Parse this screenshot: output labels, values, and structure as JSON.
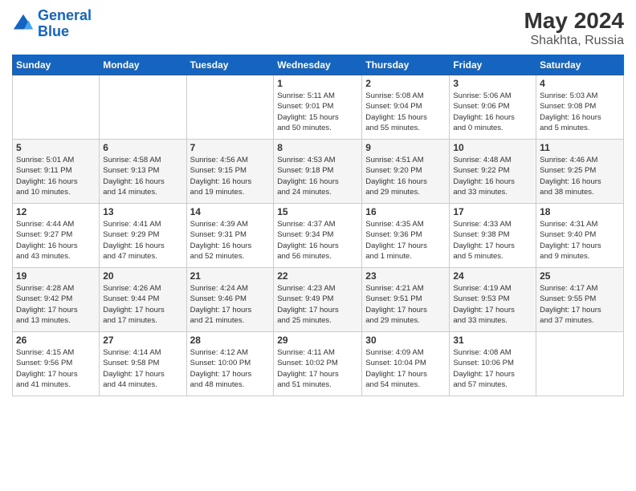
{
  "header": {
    "logo_line1": "General",
    "logo_line2": "Blue",
    "month_year": "May 2024",
    "location": "Shakhta, Russia"
  },
  "days_of_week": [
    "Sunday",
    "Monday",
    "Tuesday",
    "Wednesday",
    "Thursday",
    "Friday",
    "Saturday"
  ],
  "weeks": [
    [
      {
        "day": "",
        "info": ""
      },
      {
        "day": "",
        "info": ""
      },
      {
        "day": "",
        "info": ""
      },
      {
        "day": "1",
        "info": "Sunrise: 5:11 AM\nSunset: 9:01 PM\nDaylight: 15 hours\nand 50 minutes."
      },
      {
        "day": "2",
        "info": "Sunrise: 5:08 AM\nSunset: 9:04 PM\nDaylight: 15 hours\nand 55 minutes."
      },
      {
        "day": "3",
        "info": "Sunrise: 5:06 AM\nSunset: 9:06 PM\nDaylight: 16 hours\nand 0 minutes."
      },
      {
        "day": "4",
        "info": "Sunrise: 5:03 AM\nSunset: 9:08 PM\nDaylight: 16 hours\nand 5 minutes."
      }
    ],
    [
      {
        "day": "5",
        "info": "Sunrise: 5:01 AM\nSunset: 9:11 PM\nDaylight: 16 hours\nand 10 minutes."
      },
      {
        "day": "6",
        "info": "Sunrise: 4:58 AM\nSunset: 9:13 PM\nDaylight: 16 hours\nand 14 minutes."
      },
      {
        "day": "7",
        "info": "Sunrise: 4:56 AM\nSunset: 9:15 PM\nDaylight: 16 hours\nand 19 minutes."
      },
      {
        "day": "8",
        "info": "Sunrise: 4:53 AM\nSunset: 9:18 PM\nDaylight: 16 hours\nand 24 minutes."
      },
      {
        "day": "9",
        "info": "Sunrise: 4:51 AM\nSunset: 9:20 PM\nDaylight: 16 hours\nand 29 minutes."
      },
      {
        "day": "10",
        "info": "Sunrise: 4:48 AM\nSunset: 9:22 PM\nDaylight: 16 hours\nand 33 minutes."
      },
      {
        "day": "11",
        "info": "Sunrise: 4:46 AM\nSunset: 9:25 PM\nDaylight: 16 hours\nand 38 minutes."
      }
    ],
    [
      {
        "day": "12",
        "info": "Sunrise: 4:44 AM\nSunset: 9:27 PM\nDaylight: 16 hours\nand 43 minutes."
      },
      {
        "day": "13",
        "info": "Sunrise: 4:41 AM\nSunset: 9:29 PM\nDaylight: 16 hours\nand 47 minutes."
      },
      {
        "day": "14",
        "info": "Sunrise: 4:39 AM\nSunset: 9:31 PM\nDaylight: 16 hours\nand 52 minutes."
      },
      {
        "day": "15",
        "info": "Sunrise: 4:37 AM\nSunset: 9:34 PM\nDaylight: 16 hours\nand 56 minutes."
      },
      {
        "day": "16",
        "info": "Sunrise: 4:35 AM\nSunset: 9:36 PM\nDaylight: 17 hours\nand 1 minute."
      },
      {
        "day": "17",
        "info": "Sunrise: 4:33 AM\nSunset: 9:38 PM\nDaylight: 17 hours\nand 5 minutes."
      },
      {
        "day": "18",
        "info": "Sunrise: 4:31 AM\nSunset: 9:40 PM\nDaylight: 17 hours\nand 9 minutes."
      }
    ],
    [
      {
        "day": "19",
        "info": "Sunrise: 4:28 AM\nSunset: 9:42 PM\nDaylight: 17 hours\nand 13 minutes."
      },
      {
        "day": "20",
        "info": "Sunrise: 4:26 AM\nSunset: 9:44 PM\nDaylight: 17 hours\nand 17 minutes."
      },
      {
        "day": "21",
        "info": "Sunrise: 4:24 AM\nSunset: 9:46 PM\nDaylight: 17 hours\nand 21 minutes."
      },
      {
        "day": "22",
        "info": "Sunrise: 4:23 AM\nSunset: 9:49 PM\nDaylight: 17 hours\nand 25 minutes."
      },
      {
        "day": "23",
        "info": "Sunrise: 4:21 AM\nSunset: 9:51 PM\nDaylight: 17 hours\nand 29 minutes."
      },
      {
        "day": "24",
        "info": "Sunrise: 4:19 AM\nSunset: 9:53 PM\nDaylight: 17 hours\nand 33 minutes."
      },
      {
        "day": "25",
        "info": "Sunrise: 4:17 AM\nSunset: 9:55 PM\nDaylight: 17 hours\nand 37 minutes."
      }
    ],
    [
      {
        "day": "26",
        "info": "Sunrise: 4:15 AM\nSunset: 9:56 PM\nDaylight: 17 hours\nand 41 minutes."
      },
      {
        "day": "27",
        "info": "Sunrise: 4:14 AM\nSunset: 9:58 PM\nDaylight: 17 hours\nand 44 minutes."
      },
      {
        "day": "28",
        "info": "Sunrise: 4:12 AM\nSunset: 10:00 PM\nDaylight: 17 hours\nand 48 minutes."
      },
      {
        "day": "29",
        "info": "Sunrise: 4:11 AM\nSunset: 10:02 PM\nDaylight: 17 hours\nand 51 minutes."
      },
      {
        "day": "30",
        "info": "Sunrise: 4:09 AM\nSunset: 10:04 PM\nDaylight: 17 hours\nand 54 minutes."
      },
      {
        "day": "31",
        "info": "Sunrise: 4:08 AM\nSunset: 10:06 PM\nDaylight: 17 hours\nand 57 minutes."
      },
      {
        "day": "",
        "info": ""
      }
    ]
  ]
}
